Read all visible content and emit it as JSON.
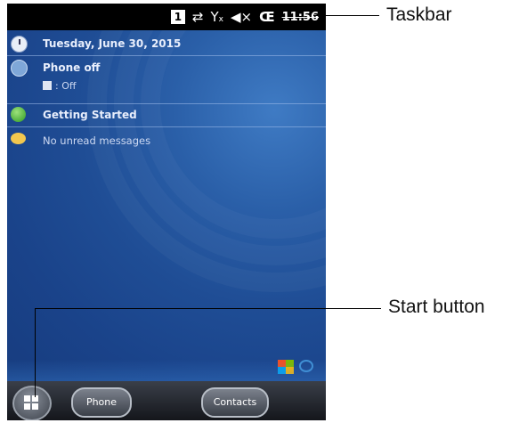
{
  "taskbar": {
    "box_digit": "1",
    "sync_icon": "sync-arrows-icon",
    "signal_icon": "signal-off-icon",
    "volume_icon": "speaker-muted-icon",
    "battery_icon": "battery-icon",
    "time": "11:56"
  },
  "today": {
    "date": "Tuesday, June 30, 2015",
    "phone_title": "Phone off",
    "phone_status": ": Off",
    "getting_started": "Getting Started",
    "messages": "No unread messages"
  },
  "bottom": {
    "phone_label": "Phone",
    "contacts_label": "Contacts"
  },
  "callouts": {
    "taskbar": "Taskbar",
    "start_button": "Start button"
  }
}
